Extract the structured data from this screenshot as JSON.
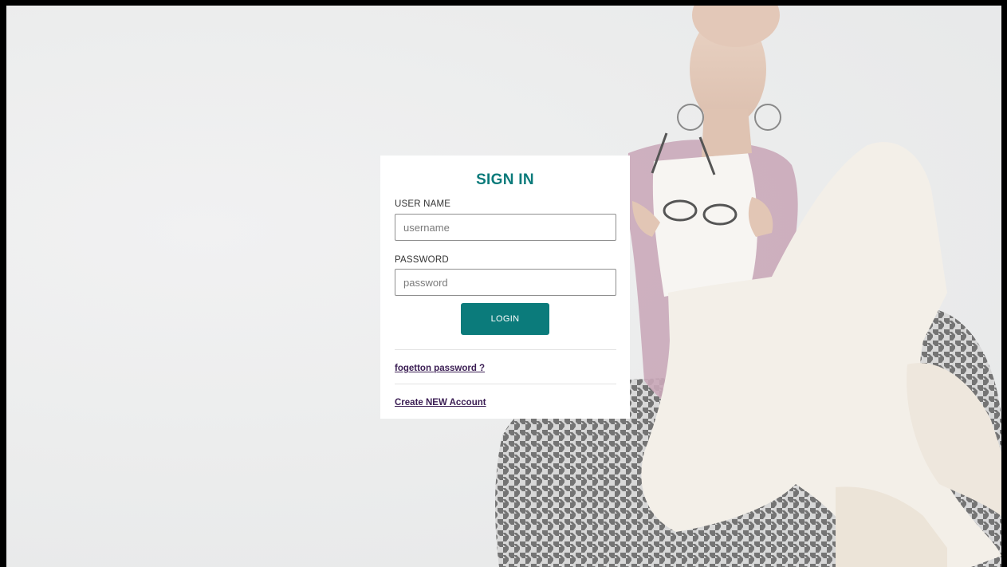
{
  "signin": {
    "title": "SIGN IN",
    "username_label": "USER NAME",
    "username_placeholder": "username",
    "username_value": "",
    "password_label": "PASSWORD",
    "password_placeholder": "password",
    "password_value": "",
    "login_label": "LOGIN",
    "forgot_link": "fogetton password ?",
    "create_link": "Create NEW Account"
  },
  "colors": {
    "accent": "#0b7b7b",
    "link": "#3b1e54",
    "card_bg": "#ffffff",
    "frame": "#000000"
  },
  "background": {
    "icon": "photo-woman-on-houndstooth-chair"
  }
}
